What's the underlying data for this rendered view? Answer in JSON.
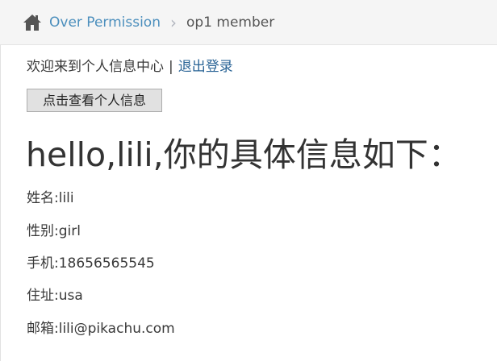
{
  "breadcrumb": {
    "home_icon": "home-icon",
    "link_label": "Over Permission",
    "separator": "›",
    "current": "op1 member"
  },
  "welcome": {
    "text": "欢迎来到个人信息中心",
    "separator": "|",
    "logout_label": "退出登录"
  },
  "view_button": {
    "label": "点击查看个人信息"
  },
  "heading": "hello,lili,你的具体信息如下：",
  "info": {
    "name": "姓名:lili",
    "gender": "性别:girl",
    "phone": "手机:18656565545",
    "address": "住址:usa",
    "email": "邮箱:lili@pikachu.com"
  },
  "colors": {
    "link": "#4c8fbd",
    "logout_link": "#2a6496",
    "breadcrumb_bg": "#f5f5f5",
    "text": "#393939"
  }
}
